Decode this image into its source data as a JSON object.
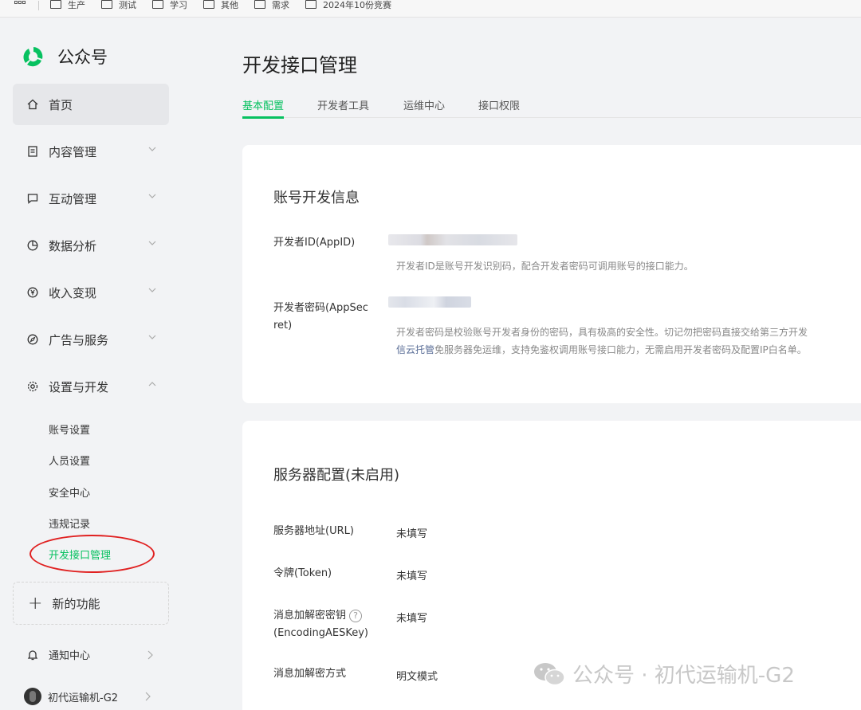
{
  "bookmarks": [
    "生产",
    "测试",
    "学习",
    "其他",
    "需求",
    "2024年10份竞赛"
  ],
  "sidebar": {
    "brand": "公众号",
    "items": [
      {
        "label": "首页",
        "icon": "home-icon"
      },
      {
        "label": "内容管理",
        "icon": "document-icon"
      },
      {
        "label": "互动管理",
        "icon": "chat-icon"
      },
      {
        "label": "数据分析",
        "icon": "pie-chart-icon"
      },
      {
        "label": "收入变现",
        "icon": "yen-icon"
      },
      {
        "label": "广告与服务",
        "icon": "compass-icon"
      },
      {
        "label": "设置与开发",
        "icon": "gear-icon"
      }
    ],
    "sub_items": [
      "账号设置",
      "人员设置",
      "安全中心",
      "违规记录",
      "开发接口管理"
    ],
    "new_feature": "新的功能",
    "notification": "通知中心",
    "account_name": "初代运输机-G2"
  },
  "main": {
    "title": "开发接口管理",
    "tabs": [
      "基本配置",
      "开发者工具",
      "运维中心",
      "接口权限"
    ],
    "dev_info": {
      "title": "账号开发信息",
      "appid_label": "开发者ID(AppID)",
      "appid_desc": "开发者ID是账号开发识别码，配合开发者密码可调用账号的接口能力。",
      "secret_label_1": "开发者密码(AppSec",
      "secret_label_2": "ret)",
      "secret_desc_1": "开发者密码是校验账号开发者身份的密码，具有极高的安全性。切记勿把密码直接交给第三方开发",
      "secret_desc_link": "信云托管",
      "secret_desc_2": "免服务器免运维，支持免鉴权调用账号接口能力，无需启用开发者密码及配置IP白名单。"
    },
    "server_config": {
      "title": "服务器配置(未启用)",
      "rows": [
        {
          "label": "服务器地址(URL)",
          "value": "未填写"
        },
        {
          "label": "令牌(Token)",
          "value": "未填写"
        },
        {
          "label": "消息加解密密钥",
          "label2": "(EncodingAESKey)",
          "value": "未填写"
        },
        {
          "label": "消息加解密方式",
          "value": "明文模式"
        }
      ]
    }
  },
  "watermark": "公众号 · 初代运输机-G2",
  "colors": {
    "accent": "#07c160",
    "link": "#576b95",
    "annotation": "#e02020"
  }
}
